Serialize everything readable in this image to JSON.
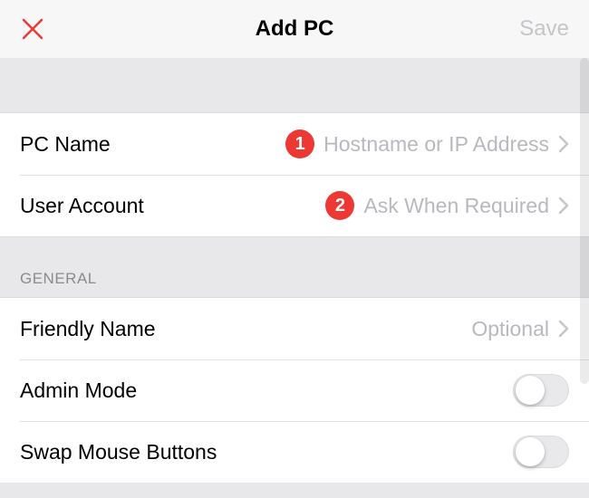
{
  "header": {
    "title": "Add PC",
    "save_label": "Save"
  },
  "section1": {
    "rows": [
      {
        "label": "PC Name",
        "badge": "1",
        "value": "Hostname or IP Address"
      },
      {
        "label": "User Account",
        "badge": "2",
        "value": "Ask When Required"
      }
    ]
  },
  "general": {
    "header": "GENERAL",
    "rows": [
      {
        "label": "Friendly Name",
        "value": "Optional",
        "kind": "disclosure"
      },
      {
        "label": "Admin Mode",
        "kind": "toggle",
        "on": false
      },
      {
        "label": "Swap Mouse Buttons",
        "kind": "toggle",
        "on": false
      }
    ]
  },
  "colors": {
    "accent": "#ed3833",
    "placeholder": "#b8b8be"
  }
}
